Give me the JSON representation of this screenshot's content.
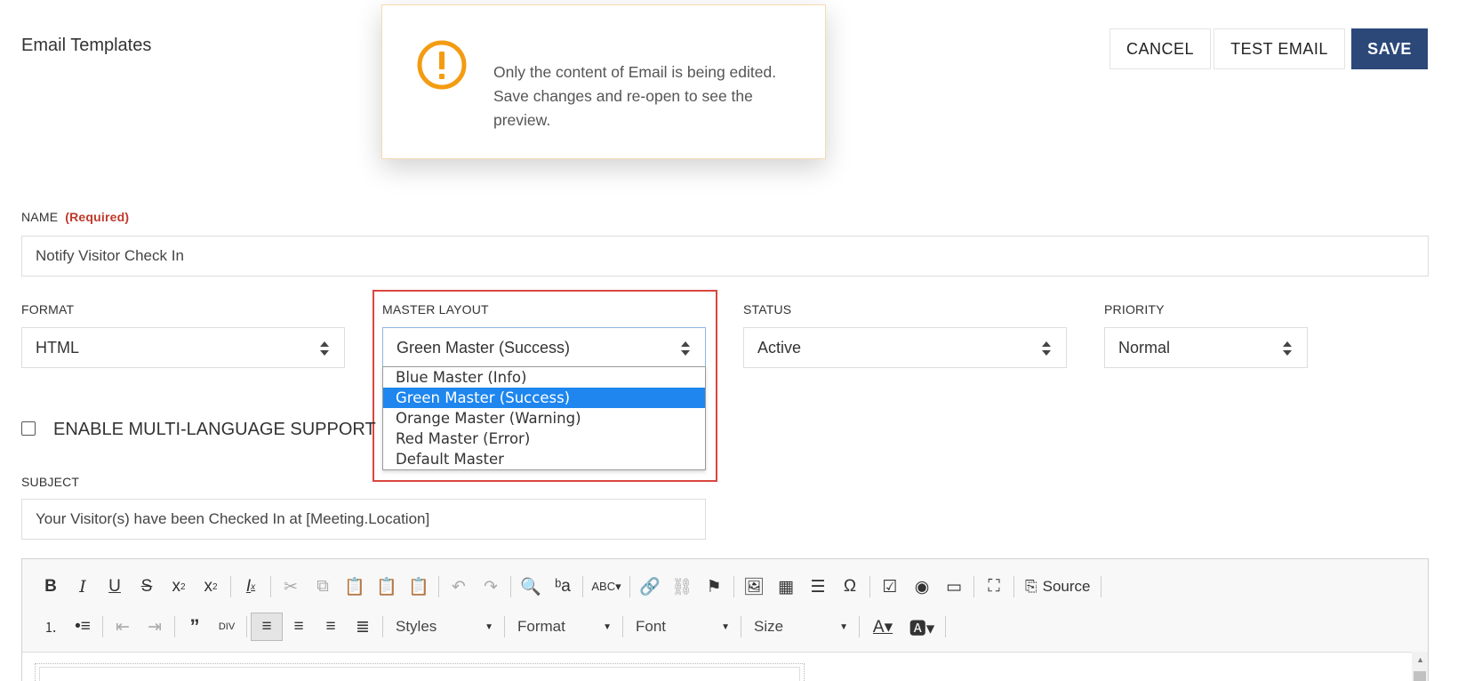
{
  "header": {
    "title": "Email Templates"
  },
  "actions": {
    "cancel": "CANCEL",
    "test_email": "TEST EMAIL",
    "save": "SAVE"
  },
  "notice": {
    "icon": "warning-icon",
    "line1": "Only the content of Email is being edited.",
    "line2": "Save changes and re-open to see the",
    "line3": "preview.",
    "accent_color": "#f39c12"
  },
  "form": {
    "name_label": "NAME",
    "name_required": "(Required)",
    "name_value": "Notify Visitor Check In",
    "format_label": "FORMAT",
    "format_value": "HTML",
    "master_label": "MASTER LAYOUT",
    "master_value": "Green Master (Success)",
    "master_options": [
      "Blue Master (Info)",
      "Green Master (Success)",
      "Orange Master (Warning)",
      "Red Master (Error)",
      "Default Master"
    ],
    "status_label": "STATUS",
    "status_value": "Active",
    "priority_label": "PRIORITY",
    "priority_value": "Normal",
    "multilang_label": "ENABLE MULTI-LANGUAGE SUPPORT",
    "subject_label": "SUBJECT",
    "subject_value": "Your Visitor(s) have been Checked In at [Meeting.Location]"
  },
  "editor": {
    "source_label": "Source",
    "styles_label": "Styles",
    "format_label": "Format",
    "font_label": "Font",
    "size_label": "Size"
  },
  "colors": {
    "primary": "#2b4879",
    "highlight": "#d9473f",
    "selected_option": "#1e86ee",
    "required": "#c0392b"
  }
}
